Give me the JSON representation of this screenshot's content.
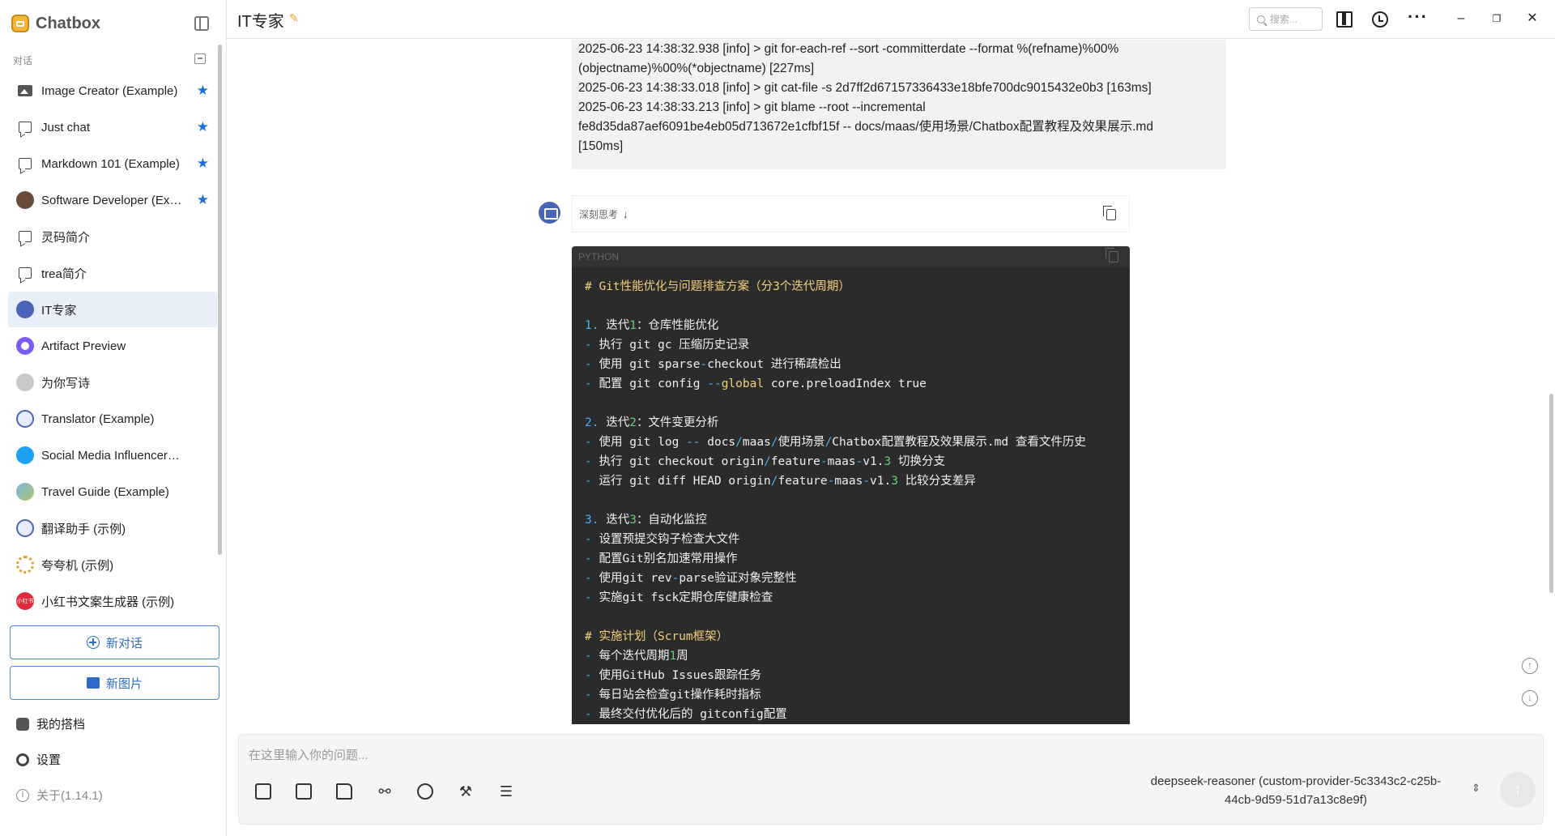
{
  "app": {
    "name": "Chatbox",
    "section_label": "对话"
  },
  "sidebar": {
    "conversations": [
      {
        "label": "Image Creator (Example)",
        "icon": "image-icon",
        "starred": true
      },
      {
        "label": "Just chat",
        "icon": "chat-bubble-icon",
        "starred": true
      },
      {
        "label": "Markdown 101 (Example)",
        "icon": "chat-bubble-icon",
        "starred": true
      },
      {
        "label": "Software Developer (Example)",
        "icon": "developer-avatar",
        "starred": true
      },
      {
        "label": "灵码简介",
        "icon": "chat-bubble-icon",
        "starred": false
      },
      {
        "label": "trea简介",
        "icon": "chat-bubble-icon",
        "starred": false
      },
      {
        "label": "IT专家",
        "icon": "it-avatar",
        "starred": false,
        "active": true
      },
      {
        "label": "Artifact Preview",
        "icon": "artifact-avatar",
        "starred": false
      },
      {
        "label": "为你写诗",
        "icon": "person-avatar",
        "starred": false
      },
      {
        "label": "Translator (Example)",
        "icon": "translator-avatar",
        "starred": false
      },
      {
        "label": "Social Media Influencer (Example)",
        "icon": "twitter-avatar",
        "starred": false
      },
      {
        "label": "Travel Guide (Example)",
        "icon": "globe-avatar",
        "starred": false
      },
      {
        "label": "翻译助手 (示例)",
        "icon": "translator-avatar",
        "starred": false
      },
      {
        "label": "夸夸机 (示例)",
        "icon": "kuakua-avatar",
        "starred": false
      },
      {
        "label": "小红书文案生成器 (示例)",
        "icon": "xiaohongshu-avatar",
        "starred": false
      }
    ],
    "new_chat_label": "新对话",
    "new_image_label": "新图片",
    "my_partners_label": "我的搭档",
    "settings_label": "设置",
    "about_label": "关于(1.14.1)",
    "xhs_badge": "小红书"
  },
  "header": {
    "title": "IT专家",
    "search_placeholder": "搜索..."
  },
  "chat": {
    "log_lines": [
      "2025-06-23 14:38:32.938 [info] > git for-each-ref --sort -committerdate --format %(refname)%00%",
      "(objectname)%00%(*objectname) [227ms]",
      "2025-06-23 14:38:33.018 [info] > git cat-file -s 2d7ff2d67157336433e18bfe700dc9015432e0b3 [163ms]",
      "2025-06-23 14:38:33.213 [info] > git blame --root --incremental",
      "fe8d35da87aef6091be4eb05d713672e1cfbf15f -- docs/maas/使用场景/Chatbox配置教程及效果展示.md",
      "[150ms]"
    ],
    "thinking_label": "深刻思考",
    "code_language": "PYTHON"
  },
  "input": {
    "placeholder": "在这里输入你的问题...",
    "model_line1": "deepseek-reasoner (custom-provider-5c3343c2-c25b-",
    "model_line2": "44cb-9d59-51d7a13c8e9f)"
  },
  "colors": {
    "accent": "#2c6cc6",
    "star": "#1f6fd9",
    "active_item_bg": "#e8eff8",
    "code_bg": "#2b2b2b",
    "code_comment": "#f2d07a",
    "code_keyword": "#4ab0e8"
  }
}
